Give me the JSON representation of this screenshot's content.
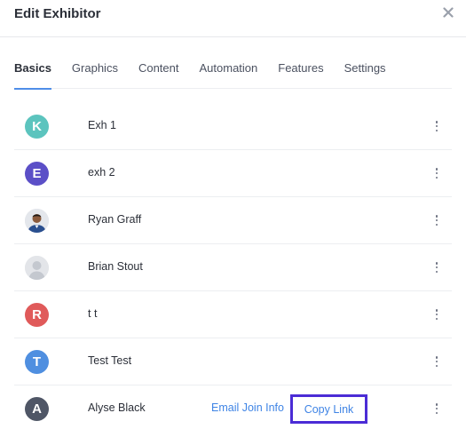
{
  "header": {
    "title": "Edit Exhibitor",
    "close_icon": "close-icon"
  },
  "tabs": [
    {
      "label": "Basics",
      "active": true
    },
    {
      "label": "Graphics",
      "active": false
    },
    {
      "label": "Content",
      "active": false
    },
    {
      "label": "Automation",
      "active": false
    },
    {
      "label": "Features",
      "active": false
    },
    {
      "label": "Settings",
      "active": false
    }
  ],
  "rows": [
    {
      "initial": "K",
      "name": "Exh 1",
      "avatar_color": "#5cc4be"
    },
    {
      "initial": "E",
      "name": "exh 2",
      "avatar_color": "#5b4fc7"
    },
    {
      "initial": "",
      "name": "Ryan Graff",
      "avatar_type": "photo"
    },
    {
      "initial": "",
      "name": "Brian Stout",
      "avatar_type": "placeholder"
    },
    {
      "initial": "R",
      "name": "t t",
      "avatar_color": "#e05a5a"
    },
    {
      "initial": "T",
      "name": "Test Test",
      "avatar_color": "#4f8fe0"
    },
    {
      "initial": "A",
      "name": "Alyse Black",
      "avatar_color": "#4f5666",
      "actions": {
        "email_join": "Email Join Info",
        "copy_link": "Copy Link"
      }
    }
  ],
  "colors": {
    "accent": "#3f84e5",
    "highlight_box": "#4b2cd6",
    "tab_underline": "#4f8ee8"
  }
}
